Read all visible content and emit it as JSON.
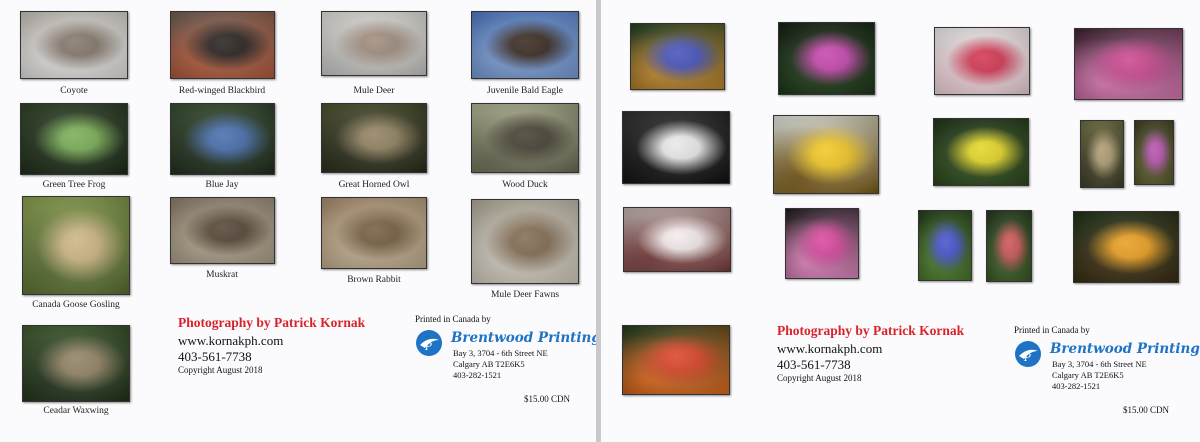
{
  "left_page": {
    "photos": [
      {
        "caption": "Coyote",
        "colors": [
          "#c9c3bb",
          "#7c6f62",
          "#eae8e6"
        ]
      },
      {
        "caption": "Red-winged Blackbird",
        "colors": [
          "#6f5a4e",
          "#1a1410",
          "#b85a3a"
        ]
      },
      {
        "caption": "Mule Deer",
        "colors": [
          "#e6e4e0",
          "#9a8676",
          "#c9c7c4"
        ]
      },
      {
        "caption": "Juvenile Bald Eagle",
        "colors": [
          "#4d78c4",
          "#2c1c12",
          "#7fa2dc"
        ]
      },
      {
        "caption": "Green Tree Frog",
        "colors": [
          "#2b3d22",
          "#6fa84a",
          "#1b2a16"
        ]
      },
      {
        "caption": "Blue Jay",
        "colors": [
          "#324a2c",
          "#3a64a8",
          "#1d2c1a"
        ]
      },
      {
        "caption": "Great Horned Owl",
        "colors": [
          "#4a4c2a",
          "#8a7a56",
          "#272a18"
        ]
      },
      {
        "caption": "Wood Duck",
        "colors": [
          "#b4b694",
          "#3a3426",
          "#6a6c52"
        ]
      },
      {
        "caption": "Canada Goose Gosling",
        "colors": [
          "#8aa04a",
          "#c8b07a",
          "#5a7032"
        ]
      },
      {
        "caption": "Muskrat",
        "colors": [
          "#8c7e6a",
          "#4a3a2a",
          "#b3a68e"
        ]
      },
      {
        "caption": "Brown Rabbit",
        "colors": [
          "#a88c6c",
          "#6c5434",
          "#c8b494"
        ]
      },
      {
        "caption": "Mule Deer Fawns",
        "colors": [
          "#b3ab9a",
          "#7a6248",
          "#d8d2c4"
        ]
      },
      {
        "caption": "Ceadar Waxwing",
        "colors": [
          "#3c5a2a",
          "#8a7a5a",
          "#1e3018"
        ]
      }
    ],
    "credit": {
      "title": "Photography by Patrick Kornak",
      "website": "www.kornakph.com",
      "phone": "403-561-7738",
      "copyright": "Copyright August 2018"
    },
    "printer": {
      "intro": "Printed in Canada by",
      "name": "Brentwood Printing",
      "address_1": "Bay 3, 3704 - 6th Street NE",
      "address_2": "Calgary AB  T2E6K5",
      "phone": "403-282-1521"
    },
    "price": "$15.00 CDN"
  },
  "right_page": {
    "photos": [
      {
        "colors": [
          "#1c3a1c",
          "#3a48b8",
          "#c88a2a"
        ]
      },
      {
        "colors": [
          "#0e1a0c",
          "#c23aa8",
          "#1c3a16"
        ]
      },
      {
        "colors": [
          "#f4f2f2",
          "#d02a48",
          "#f0d2da"
        ]
      },
      {
        "colors": [
          "#3a1c2c",
          "#c83c8a",
          "#e27ab8"
        ]
      },
      {
        "colors": [
          "#2a2a2a",
          "#e8e8e8",
          "#0e0e0e"
        ]
      },
      {
        "colors": [
          "#e8ece6",
          "#f2c418",
          "#7a5a14"
        ]
      },
      {
        "colors": [
          "#1a3212",
          "#e2d418",
          "#2c4a1a"
        ]
      },
      {
        "colors": [
          "#6a6a3a",
          "#a89468",
          "#3a3a22"
        ]
      },
      {
        "colors": [
          "#3a3a1c",
          "#b048a8",
          "#5a5a2a"
        ]
      },
      {
        "colors": [
          "#c8b8b4",
          "#f4eaea",
          "#7a3a3a"
        ]
      },
      {
        "colors": [
          "#1a1418",
          "#d83c98",
          "#e888c4"
        ]
      },
      {
        "colors": [
          "#1a3a12",
          "#3a48c8",
          "#4a7a28"
        ]
      },
      {
        "colors": [
          "#1c3414",
          "#c84a4a",
          "#3a5a22"
        ]
      },
      {
        "colors": [
          "#1a2c10",
          "#e89812",
          "#3a2c10"
        ]
      },
      {
        "colors": [
          "#1a3614",
          "#d83818",
          "#e86a1a"
        ]
      }
    ],
    "credit": {
      "title": "Photography by Patrick Kornak",
      "website": "www.kornakph.com",
      "phone": "403-561-7738",
      "copyright": "Copyright August 2018"
    },
    "printer": {
      "intro": "Printed in Canada by",
      "name": "Brentwood Printing",
      "address_1": "Bay 3, 3704 - 6th Street NE",
      "address_2": "Calgary AB  T2E6K5",
      "phone": "403-282-1521"
    },
    "price": "$15.00 CDN"
  }
}
